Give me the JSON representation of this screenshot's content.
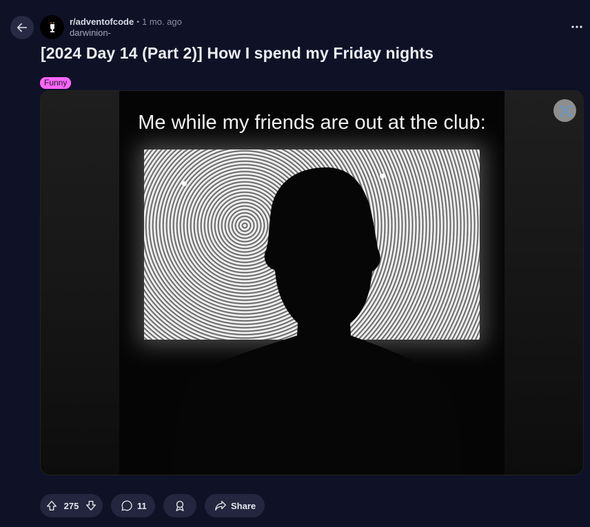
{
  "post": {
    "subreddit": "r/adventofcode",
    "separator": "•",
    "time": "1 mo. ago",
    "author": "darwinion-",
    "title": "[2024 Day 14 (Part 2)] How I spend my Friday nights",
    "flair": "Funny",
    "flair_color": "#ff66ff"
  },
  "media": {
    "caption": "Me while my friends are out at the club:"
  },
  "actions": {
    "upvotes": "275",
    "comments": "11",
    "share_label": "Share"
  },
  "icons": {
    "back": "arrow-left-icon",
    "more": "more-horizontal-icon",
    "expand": "expand-icon",
    "upvote": "upvote-icon",
    "downvote": "downvote-icon",
    "comment": "comment-icon",
    "award": "award-icon",
    "share": "share-icon"
  },
  "colors": {
    "background": "#0f1126",
    "button_bg": "#23263e"
  }
}
